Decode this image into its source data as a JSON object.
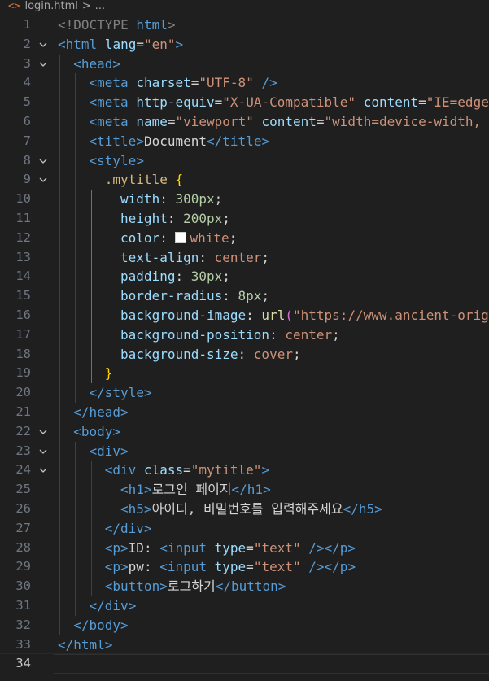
{
  "breadcrumb": {
    "file": "login.html",
    "separator": ">",
    "more": "..."
  },
  "colors": {
    "white_swatch": "#ffffff"
  },
  "lines": [
    [
      "<!DOCTYPE",
      " html",
      ">"
    ],
    [
      "<html",
      " lang",
      "=",
      "\"en\"",
      ">"
    ],
    [
      "<head",
      ">"
    ],
    [
      "<meta",
      " charset",
      "=",
      "\"UTF-8\"",
      " />"
    ],
    [
      "<meta",
      " http-equiv",
      "=",
      "\"X-UA-Compatible\"",
      " content",
      "=",
      "\"IE=edge"
    ],
    [
      "<meta",
      " name",
      "=",
      "\"viewport\"",
      " content",
      "=",
      "\"width=device-width,"
    ],
    [
      "<title",
      ">",
      "Document",
      "</title",
      ">"
    ],
    [
      "<style",
      ">"
    ],
    [
      ".mytitle",
      " {"
    ],
    [
      "width",
      ": ",
      "300px",
      ";"
    ],
    [
      "height",
      ": ",
      "200px",
      ";"
    ],
    [
      "color",
      ": ",
      "white",
      ";"
    ],
    [
      "text-align",
      ": ",
      "center",
      ";"
    ],
    [
      "padding",
      ": ",
      "30px",
      ";"
    ],
    [
      "border-radius",
      ": ",
      "8px",
      ";"
    ],
    [
      "background-image",
      ": ",
      "url",
      "(",
      "\"https://www.ancient-orig"
    ],
    [
      "background-position",
      ": ",
      "center",
      ";"
    ],
    [
      "background-size",
      ": ",
      "cover",
      ";"
    ],
    [
      "}"
    ],
    [
      "</style",
      ">"
    ],
    [
      "</head",
      ">"
    ],
    [
      "<body",
      ">"
    ],
    [
      "<div",
      ">"
    ],
    [
      "<div",
      " class",
      "=",
      "\"mytitle\"",
      ">"
    ],
    [
      "<h1",
      ">",
      "로그인 페이지",
      "</h1",
      ">"
    ],
    [
      "<h5",
      ">",
      "아이디, 비밀번호를 입력해주세요",
      "</h5",
      ">"
    ],
    [
      "</div",
      ">"
    ],
    [
      "<p",
      ">",
      "ID: ",
      "<input",
      " type",
      "=",
      "\"text\"",
      " />",
      "</p",
      ">"
    ],
    [
      "<p",
      ">",
      "pw: ",
      "<input",
      " type",
      "=",
      "\"text\"",
      " />",
      "</p",
      ">"
    ],
    [
      "<button",
      ">",
      "로그하기",
      "</button",
      ">"
    ],
    [
      "</div",
      ">"
    ],
    [
      "</body",
      ">"
    ],
    [
      "</html",
      ">"
    ],
    []
  ],
  "line_numbers": [
    "1",
    "2",
    "3",
    "4",
    "5",
    "6",
    "7",
    "8",
    "9",
    "10",
    "11",
    "12",
    "13",
    "14",
    "15",
    "16",
    "17",
    "18",
    "19",
    "20",
    "21",
    "22",
    "23",
    "24",
    "25",
    "26",
    "27",
    "28",
    "29",
    "30",
    "31",
    "32",
    "33",
    "34"
  ]
}
